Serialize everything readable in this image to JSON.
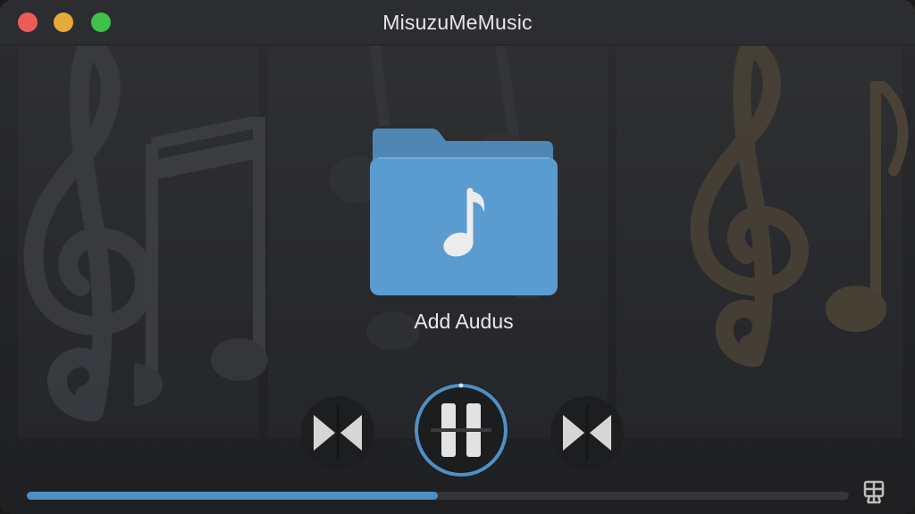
{
  "window": {
    "title": "MisuzuMeMusic"
  },
  "main": {
    "add_label": "Add Audus"
  },
  "player": {
    "progress_fraction": 0.5
  },
  "icons": {
    "close": "close-icon",
    "minimize": "minimize-icon",
    "maximize": "maximize-icon",
    "folder": "music-folder-icon",
    "previous": "previous-track-icon",
    "pause": "pause-icon",
    "next": "next-track-icon",
    "corner": "playlist-icon"
  },
  "colors": {
    "accent": "#4e8fc4",
    "folder": "#5a9bd0",
    "close": "#ee5b57",
    "minimize": "#e6a83a",
    "maximize": "#3fc24c"
  }
}
